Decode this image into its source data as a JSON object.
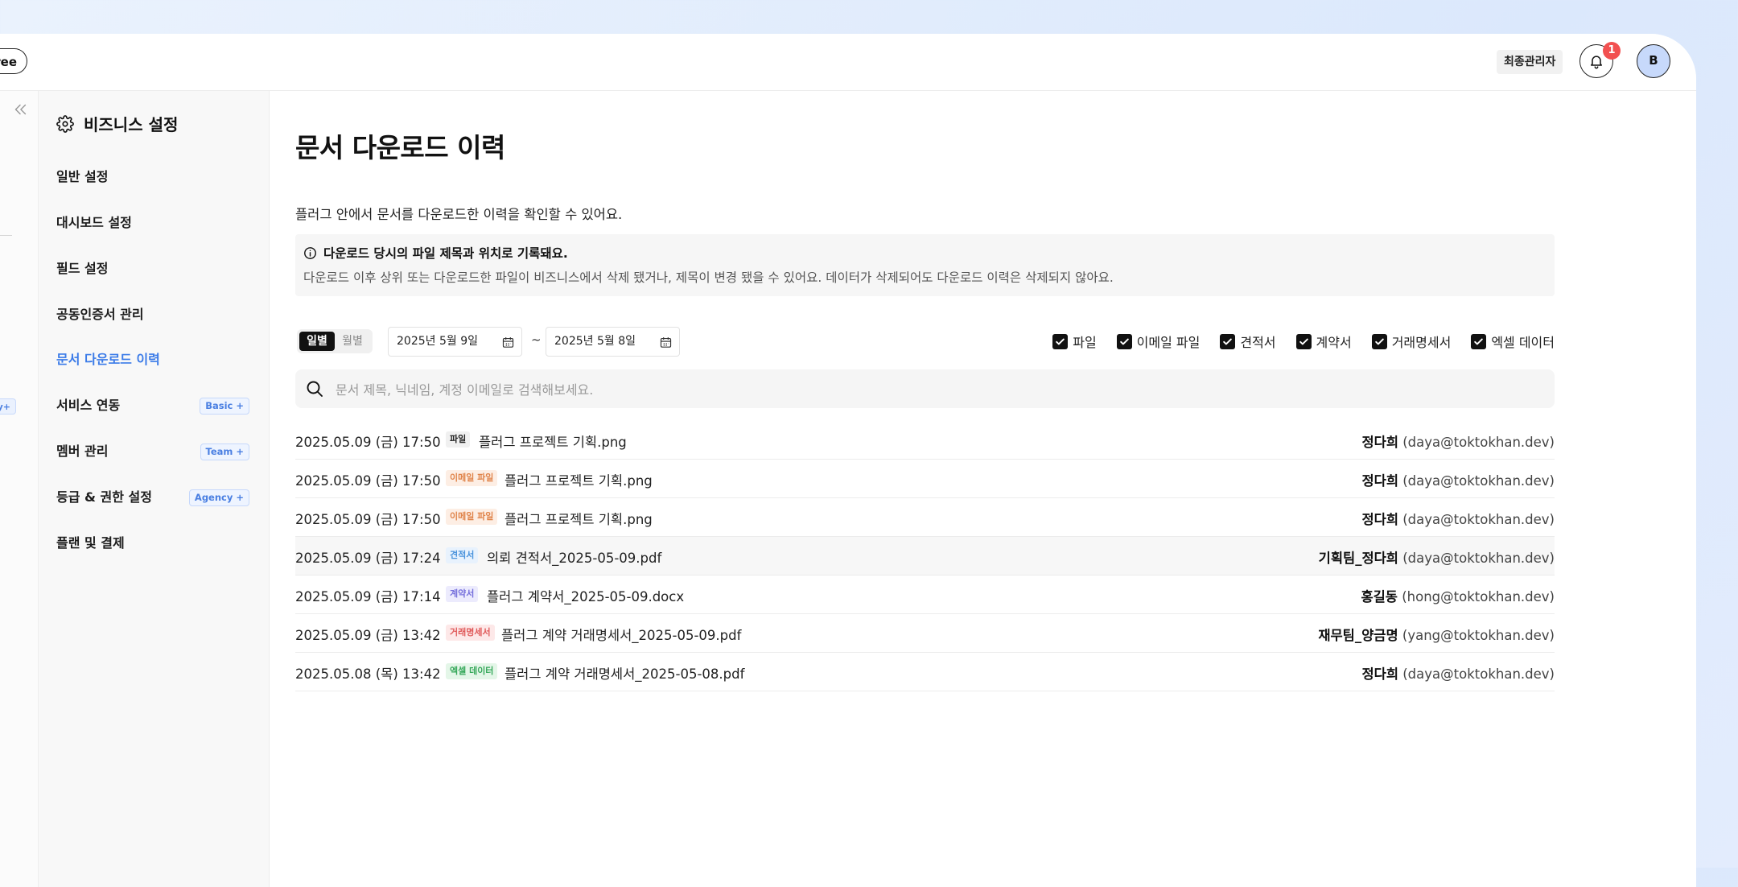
{
  "topbar": {
    "plan_label": "ree",
    "role": "최종관리자",
    "notification_count": "1",
    "avatar_initial": "B"
  },
  "leftnav": {
    "partial_badge": "y+"
  },
  "sidebar": {
    "title": "비즈니스 설정",
    "items": [
      {
        "label": "일반 설정",
        "tag": ""
      },
      {
        "label": "대시보드 설정",
        "tag": ""
      },
      {
        "label": "필드 설정",
        "tag": ""
      },
      {
        "label": "공동인증서 관리",
        "tag": ""
      },
      {
        "label": "문서 다운로드 이력",
        "tag": "",
        "active": true
      },
      {
        "label": "서비스 연동",
        "tag": "Basic +"
      },
      {
        "label": "멤버 관리",
        "tag": "Team +"
      },
      {
        "label": "등급 & 권한 설정",
        "tag": "Agency +"
      },
      {
        "label": "플랜 및 결제",
        "tag": ""
      }
    ]
  },
  "main": {
    "title": "문서 다운로드 이력",
    "description": "플러그 안에서 문서를 다운로드한 이력을 확인할 수 있어요.",
    "notice": {
      "title": "다운로드 당시의 파일 제목과 위치로 기록돼요.",
      "text": "다운로드 이후 상위 또는 다운로드한 파일이 비즈니스에서 삭제 됐거나, 제목이 변경 됐을 수 있어요. 데이터가 삭제되어도 다운로드 이력은 삭제되지 않아요."
    },
    "period_tabs": [
      "일별",
      "월별"
    ],
    "date_from": "2025년 5월 9일",
    "date_sep": "~",
    "date_to": "2025년 5월 8일",
    "filters": [
      "파일",
      "이메일 파일",
      "견적서",
      "계약서",
      "거래명세서",
      "엑셀 데이터"
    ],
    "search_placeholder": "문서 제목, 닉네임, 계정 이메일로 검색해보세요.",
    "rows": [
      {
        "date": "2025.05.09 (금) 17:50",
        "tag": "파일",
        "file": "플러그 프로젝트 기획.png",
        "user": "정다희",
        "email": "(daya@toktokhan.dev)"
      },
      {
        "date": "2025.05.09 (금) 17:50",
        "tag": "이메일 파일",
        "file": "플러그 프로젝트 기획.png",
        "user": "정다희",
        "email": "(daya@toktokhan.dev)"
      },
      {
        "date": "2025.05.09 (금) 17:50",
        "tag": "이메일 파일",
        "file": "플러그 프로젝트 기획.png",
        "user": "정다희",
        "email": "(daya@toktokhan.dev)"
      },
      {
        "date": "2025.05.09 (금) 17:24",
        "tag": "견적서",
        "file": "의뢰 견적서_2025-05-09.pdf",
        "user": "기획팀_정다희",
        "email": "(daya@toktokhan.dev)"
      },
      {
        "date": "2025.05.09 (금) 17:14",
        "tag": "계약서",
        "file": "플러그 계약서_2025-05-09.docx",
        "user": "홍길동",
        "email": "(hong@toktokhan.dev)"
      },
      {
        "date": "2025.05.09 (금) 13:42",
        "tag": "거래명세서",
        "file": "플러그 계약 거래명세서_2025-05-09.pdf",
        "user": "재무팀_양금명",
        "email": "(yang@toktokhan.dev)"
      },
      {
        "date": "2025.05.08 (목) 13:42",
        "tag": "엑셀 데이터",
        "file": "플러그 계약 거래명세서_2025-05-08.pdf",
        "user": "정다희",
        "email": "(daya@toktokhan.dev)"
      }
    ]
  },
  "colors": {
    "accent": "#3b7be8",
    "tag_file": "#f0f0f0",
    "tag_email": "#fdeee4",
    "tag_quote": "#e8f2fd",
    "tag_contract": "#ecebfd",
    "tag_statement": "#fde8e8",
    "tag_excel": "#e4f6e8"
  }
}
